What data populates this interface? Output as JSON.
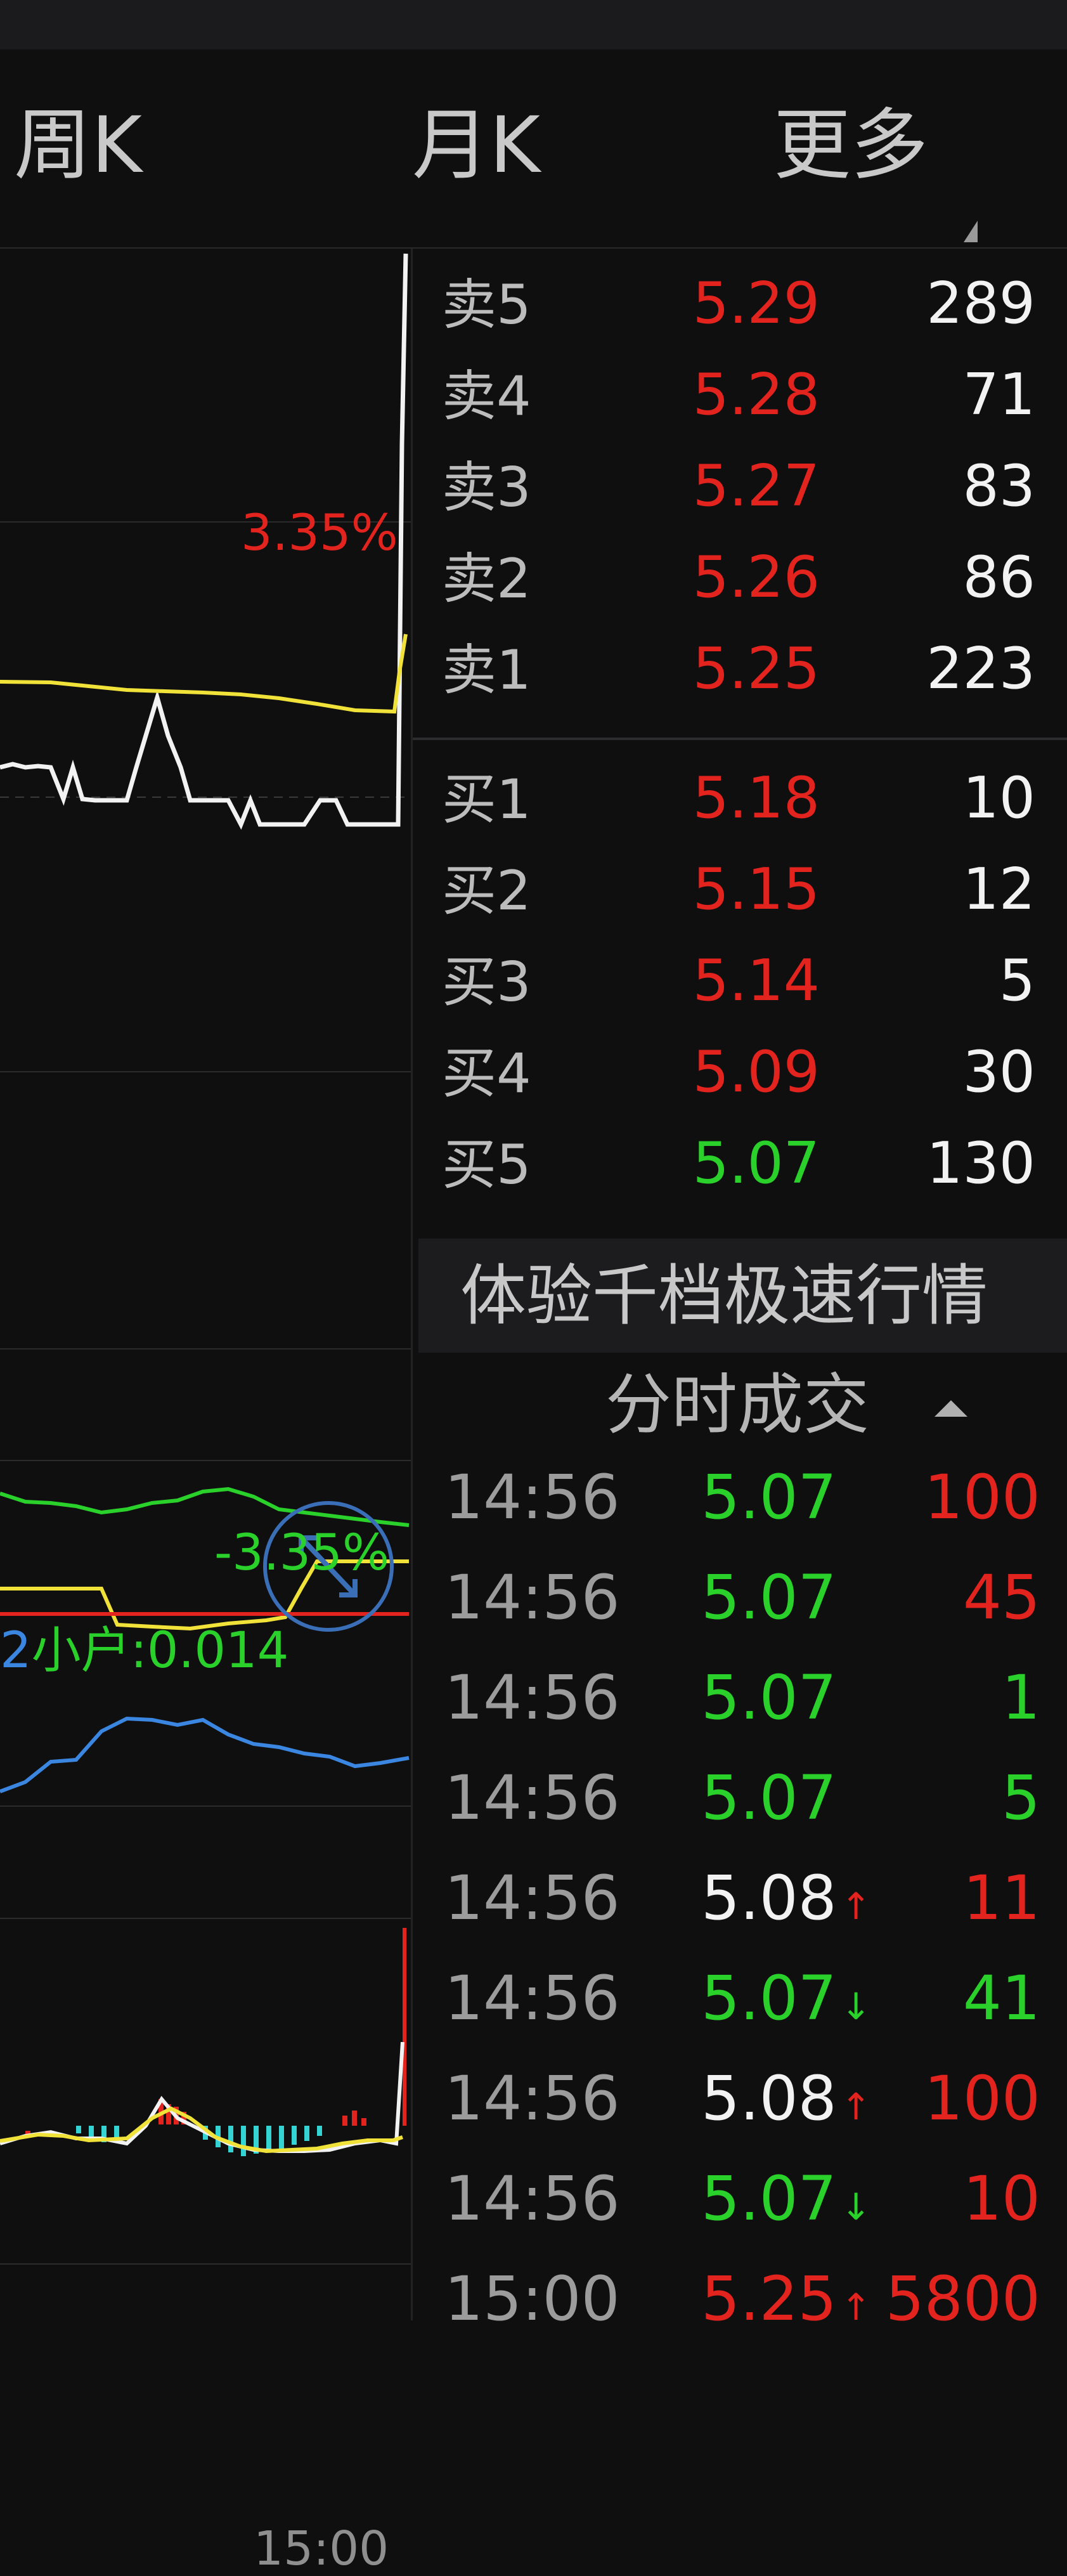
{
  "tabs": [
    {
      "label": "周K"
    },
    {
      "label": "月K"
    },
    {
      "label": "更多"
    }
  ],
  "chart": {
    "high_pct": "3.35%",
    "low_pct": "-3.35%",
    "retail_label": "小户:0.014",
    "end_time": "15:00"
  },
  "order_book": {
    "asks": [
      {
        "label": "卖5",
        "price": "5.29",
        "volume": "289",
        "price_color": "red"
      },
      {
        "label": "卖4",
        "price": "5.28",
        "volume": "71",
        "price_color": "red"
      },
      {
        "label": "卖3",
        "price": "5.27",
        "volume": "83",
        "price_color": "red"
      },
      {
        "label": "卖2",
        "price": "5.26",
        "volume": "86",
        "price_color": "red"
      },
      {
        "label": "卖1",
        "price": "5.25",
        "volume": "223",
        "price_color": "red"
      }
    ],
    "bids": [
      {
        "label": "买1",
        "price": "5.18",
        "volume": "10",
        "price_color": "red"
      },
      {
        "label": "买2",
        "price": "5.15",
        "volume": "12",
        "price_color": "red"
      },
      {
        "label": "买3",
        "price": "5.14",
        "volume": "5",
        "price_color": "red"
      },
      {
        "label": "买4",
        "price": "5.09",
        "volume": "30",
        "price_color": "red"
      },
      {
        "label": "买5",
        "price": "5.07",
        "volume": "130",
        "price_color": "green"
      }
    ]
  },
  "promo": {
    "label": "体验千档极速行情"
  },
  "ticks": {
    "header": "分时成交",
    "rows": [
      {
        "time": "14:56",
        "price": "5.07",
        "arrow": "",
        "volume": "100",
        "price_color": "green",
        "vol_color": "red"
      },
      {
        "time": "14:56",
        "price": "5.07",
        "arrow": "",
        "volume": "45",
        "price_color": "green",
        "vol_color": "red"
      },
      {
        "time": "14:56",
        "price": "5.07",
        "arrow": "",
        "volume": "1",
        "price_color": "green",
        "vol_color": "green"
      },
      {
        "time": "14:56",
        "price": "5.07",
        "arrow": "",
        "volume": "5",
        "price_color": "green",
        "vol_color": "green"
      },
      {
        "time": "14:56",
        "price": "5.08",
        "arrow": "↑",
        "volume": "11",
        "price_color": "white",
        "vol_color": "red"
      },
      {
        "time": "14:56",
        "price": "5.07",
        "arrow": "↓",
        "volume": "41",
        "price_color": "green",
        "vol_color": "green"
      },
      {
        "time": "14:56",
        "price": "5.08",
        "arrow": "↑",
        "volume": "100",
        "price_color": "white",
        "vol_color": "red"
      },
      {
        "time": "14:56",
        "price": "5.07",
        "arrow": "↓",
        "volume": "10",
        "price_color": "green",
        "vol_color": "red"
      },
      {
        "time": "15:00",
        "price": "5.25",
        "arrow": "↑",
        "volume": "5800",
        "price_color": "red",
        "vol_color": "red"
      }
    ]
  },
  "colors": {
    "red": "#e3231e",
    "green": "#2bd12b",
    "yellow": "#f1e23a",
    "blue": "#3a86e0",
    "cyan": "#34d4d4"
  }
}
